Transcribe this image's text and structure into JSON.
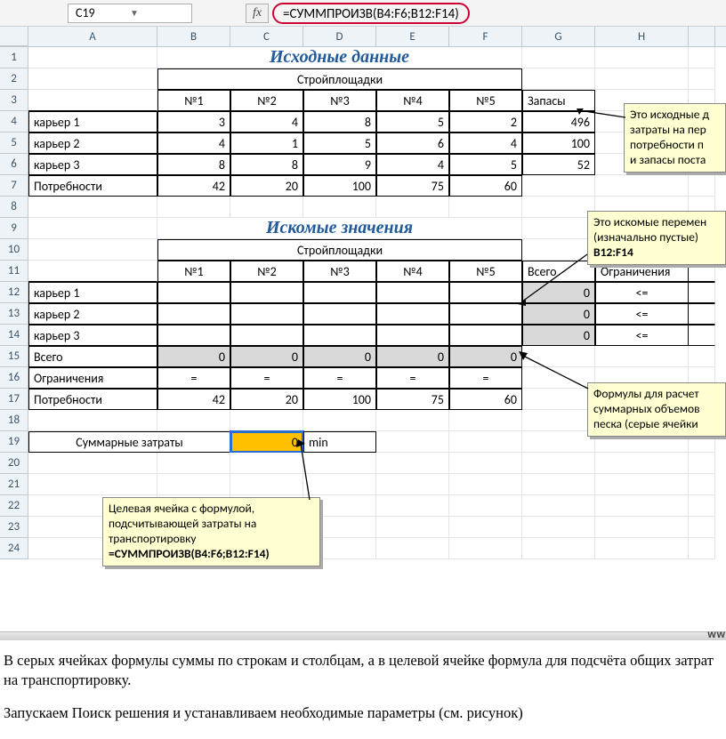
{
  "formula_bar": {
    "cell_ref": "C19",
    "fx_label": "fx",
    "formula": "=СУММПРОИЗВ(B4:F6;B12:F14)"
  },
  "column_labels": [
    "A",
    "B",
    "C",
    "D",
    "E",
    "F",
    "G",
    "H"
  ],
  "row_numbers": [
    "1",
    "2",
    "3",
    "4",
    "5",
    "6",
    "7",
    "8",
    "9",
    "10",
    "11",
    "12",
    "13",
    "14",
    "15",
    "16",
    "17",
    "18",
    "19",
    "20",
    "21",
    "22",
    "23",
    "24"
  ],
  "titles": {
    "t1": "Исходные данные",
    "t2": "Искомые значения"
  },
  "labels": {
    "sites": "Стройплощадки",
    "n1": "№1",
    "n2": "№2",
    "n3": "№3",
    "n4": "№4",
    "n5": "№5",
    "zap": "Запасы",
    "k1": "карьер 1",
    "k2": "карьер 2",
    "k3": "карьер 3",
    "potr": "Потребности",
    "vsego": "Всего",
    "ogr": "Ограничения",
    "sumz": "Суммарные затраты",
    "min": "min",
    "le": "<=",
    "eq": "="
  },
  "table1": {
    "r4": [
      "3",
      "4",
      "8",
      "5",
      "2",
      "496"
    ],
    "r5": [
      "4",
      "1",
      "5",
      "6",
      "4",
      "100"
    ],
    "r6": [
      "8",
      "8",
      "9",
      "4",
      "5",
      "52"
    ],
    "r7": [
      "42",
      "20",
      "100",
      "75",
      "60"
    ]
  },
  "table2": {
    "g12": "0",
    "g13": "0",
    "g14": "0",
    "r15": [
      "0",
      "0",
      "0",
      "0",
      "0"
    ],
    "r17": [
      "42",
      "20",
      "100",
      "75",
      "60"
    ]
  },
  "target_value": "0",
  "callouts": {
    "c1_l1": "Это исходные д",
    "c1_l2": "затраты на пер",
    "c1_l3": "потребности п",
    "c1_l4": "и запасы поста",
    "c2_l1": "Это искомые перемен",
    "c2_l2": "(изначально пустые)",
    "c2_l3": "B12:F14",
    "c3_l1": "Формулы для расчет",
    "c3_l2": "суммарных объемов",
    "c3_l3": "песка (серые ячейки",
    "c4_l1": "Целевая ячейка с формулой,",
    "c4_l2": "подсчитывающей затраты на",
    "c4_l3": "транспортировку",
    "c4_l4": "=СУММПРОИЗВ(B4:F6;B12:F14)"
  },
  "footer": {
    "p1": "В серых ячейках формулы суммы по строкам и столбцам, а в целевой ячейке формула для подсчёта общих затрат на транспортировку.",
    "p2": "Запускаем Поиск решения и устанавливаем необходимые параметры (см. рисунок)"
  },
  "watermark": "ww"
}
